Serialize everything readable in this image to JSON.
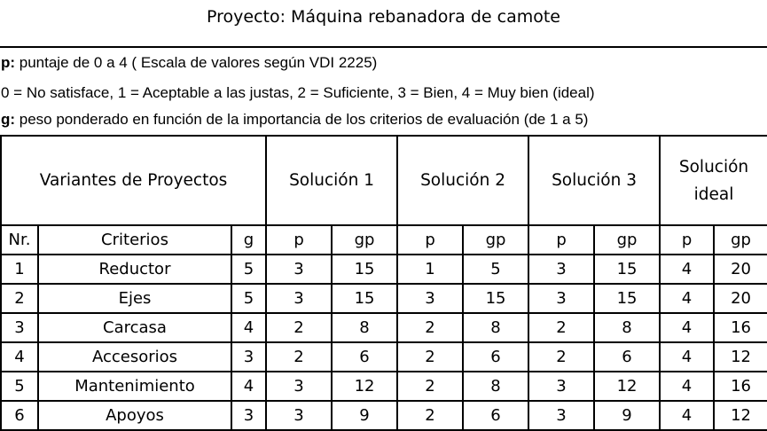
{
  "title": "Proyecto: Máquina rebanadora de camote",
  "legend": {
    "p_key": "p:",
    "p_text": " puntaje de 0 a 4 ( Escala de valores según VDI 2225)",
    "scale_text": "0 = No satisface, 1 = Aceptable a las justas, 2 = Suficiente, 3 = Bien, 4 = Muy bien (ideal)",
    "g_key": "g:",
    "g_text": " peso ponderado en función de la importancia de los criterios de evaluación (de 1 a 5)"
  },
  "table": {
    "header": {
      "variants": "Variantes de Proyectos",
      "solution1": "Solución 1",
      "solution2": "Solución 2",
      "solution3": "Solución 3",
      "ideal": "Solución ideal"
    },
    "subheader": {
      "nr": "Nr.",
      "criterios": "Criterios",
      "g": "g",
      "p1": "p",
      "gp1": "gp",
      "p2": "p",
      "gp2": "gp",
      "p3": "p",
      "gp3": "gp",
      "pi": "p",
      "gpi": "gp"
    },
    "rows": [
      {
        "nr": "1",
        "criterio": "Reductor",
        "g": "5",
        "p1": "3",
        "gp1": "15",
        "p2": "1",
        "gp2": "5",
        "p3": "3",
        "gp3": "15",
        "pi": "4",
        "gpi": "20"
      },
      {
        "nr": "2",
        "criterio": "Ejes",
        "g": "5",
        "p1": "3",
        "gp1": "15",
        "p2": "3",
        "gp2": "15",
        "p3": "3",
        "gp3": "15",
        "pi": "4",
        "gpi": "20"
      },
      {
        "nr": "3",
        "criterio": "Carcasa",
        "g": "4",
        "p1": "2",
        "gp1": "8",
        "p2": "2",
        "gp2": "8",
        "p3": "2",
        "gp3": "8",
        "pi": "4",
        "gpi": "16"
      },
      {
        "nr": "4",
        "criterio": "Accesorios",
        "g": "3",
        "p1": "2",
        "gp1": "6",
        "p2": "2",
        "gp2": "6",
        "p3": "2",
        "gp3": "6",
        "pi": "4",
        "gpi": "12"
      },
      {
        "nr": "5",
        "criterio": "Mantenimiento",
        "g": "4",
        "p1": "3",
        "gp1": "12",
        "p2": "2",
        "gp2": "8",
        "p3": "3",
        "gp3": "12",
        "pi": "4",
        "gpi": "16"
      },
      {
        "nr": "6",
        "criterio": "Apoyos",
        "g": "3",
        "p1": "3",
        "gp1": "9",
        "p2": "2",
        "gp2": "6",
        "p3": "3",
        "gp3": "9",
        "pi": "4",
        "gpi": "12"
      }
    ]
  }
}
